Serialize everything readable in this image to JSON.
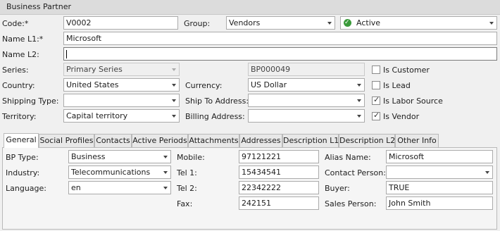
{
  "window": {
    "title": "Business Partner"
  },
  "header": {
    "code_label": "Code:*",
    "code_value": "V0002",
    "group_label": "Group:",
    "group_value": "Vendors",
    "status_value": "Active",
    "name1_label": "Name L1:*",
    "name1_value": "Microsoft",
    "name2_label": "Name L2:",
    "name2_value": "",
    "series_label": "Series:",
    "series_value": "Primary Series",
    "series_number": "BP000049",
    "country_label": "Country:",
    "country_value": "United States",
    "currency_label": "Currency:",
    "currency_value": "US Dollar",
    "shipping_type_label": "Shipping Type:",
    "shipping_type_value": "",
    "ship_to_label": "Ship To Address:",
    "ship_to_value": "",
    "territory_label": "Territory:",
    "territory_value": "Capital territory",
    "billing_label": "Billing Address:",
    "billing_value": ""
  },
  "flags": [
    {
      "label": "Is Customer",
      "checked": false
    },
    {
      "label": "Is Lead",
      "checked": false
    },
    {
      "label": "Is Labor Source",
      "checked": true
    },
    {
      "label": "Is Vendor",
      "checked": true
    }
  ],
  "tabs": [
    "General",
    "Social Profiles",
    "Contacts",
    "Active Periods",
    "Attachments",
    "Addresses",
    "Description L1",
    "Description L2",
    "Other Info"
  ],
  "general": {
    "bp_type_label": "BP Type:",
    "bp_type_value": "Business",
    "industry_label": "Industry:",
    "industry_value": "Telecommunications",
    "language_label": "Language:",
    "language_value": "en",
    "mobile_label": "Mobile:",
    "mobile_value": "97121221",
    "tel1_label": "Tel 1:",
    "tel1_value": "15434541",
    "tel2_label": "Tel 2:",
    "tel2_value": "22342222",
    "fax_label": "Fax:",
    "fax_value": "242151",
    "alias_label": "Alias Name:",
    "alias_value": "Microsoft",
    "contact_label": "Contact Person:",
    "contact_value": "",
    "buyer_label": "Buyer:",
    "buyer_value": "TRUE",
    "sales_label": "Sales Person:",
    "sales_value": "John Smith"
  }
}
